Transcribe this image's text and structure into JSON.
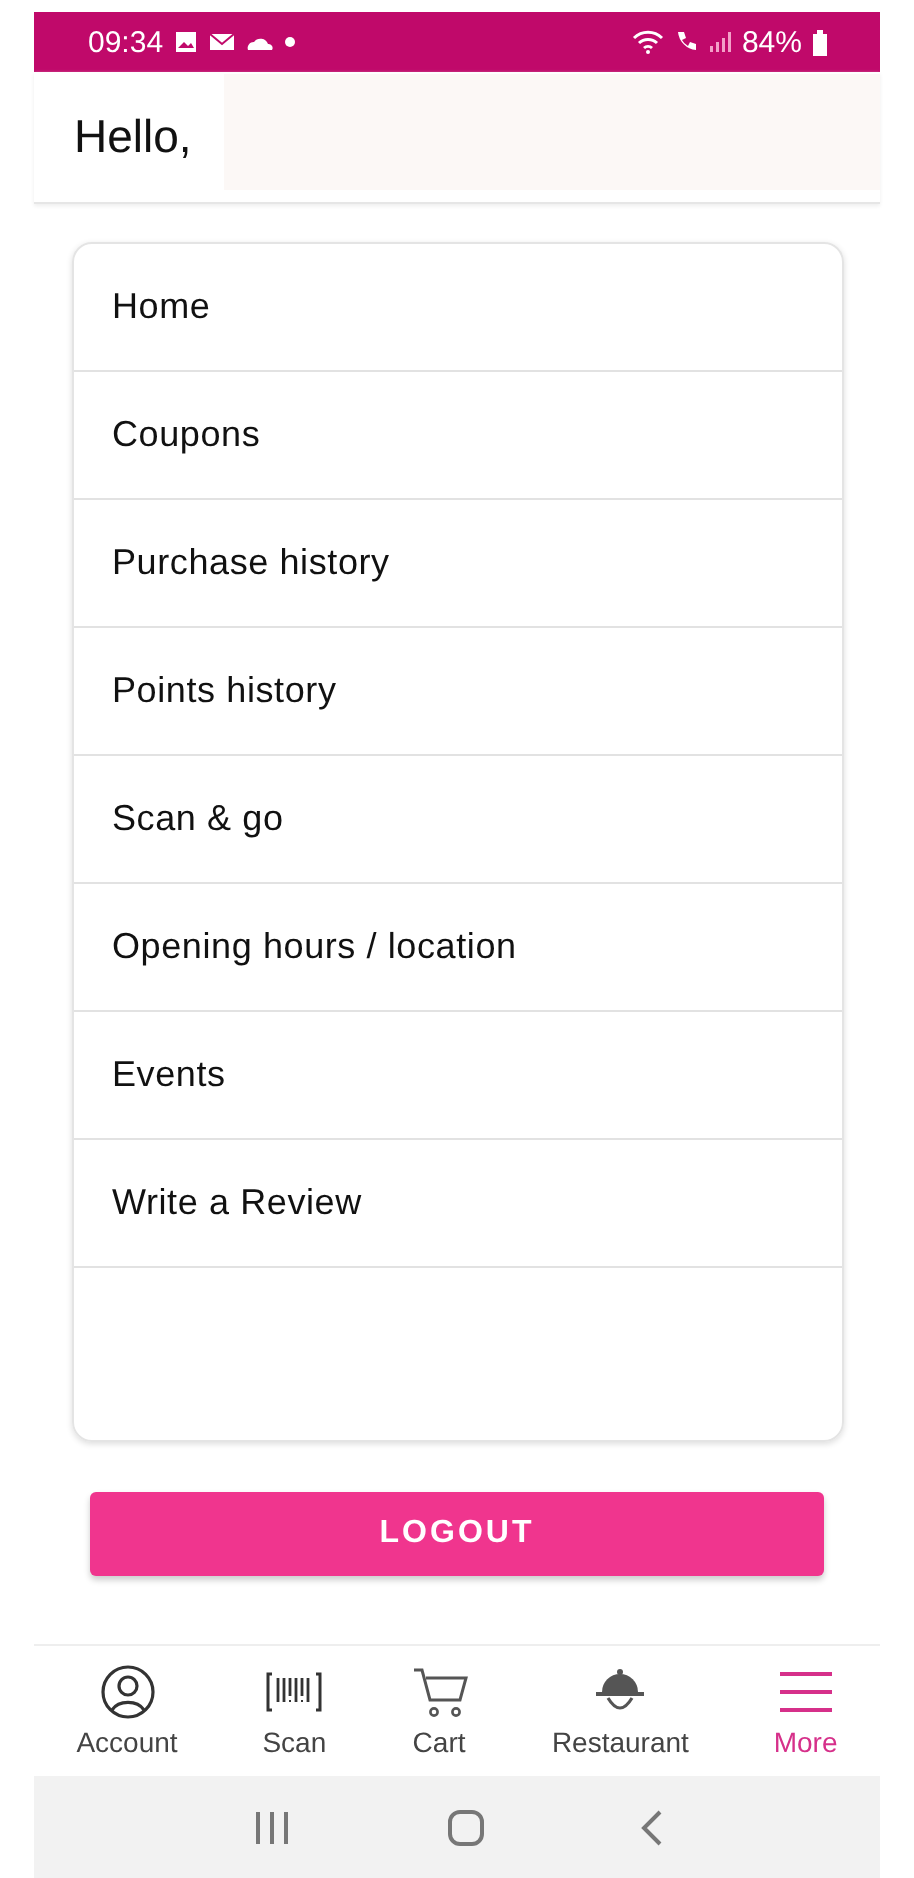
{
  "status_bar": {
    "time": "09:34",
    "battery": "84%"
  },
  "header": {
    "greeting": "Hello,"
  },
  "menu": [
    {
      "label": "Home"
    },
    {
      "label": "Coupons"
    },
    {
      "label": "Purchase history"
    },
    {
      "label": "Points history"
    },
    {
      "label": "Scan & go"
    },
    {
      "label": "Opening hours / location"
    },
    {
      "label": "Events"
    },
    {
      "label": "Write a Review"
    }
  ],
  "logout_button": "LOGOUT",
  "bottom_nav": [
    {
      "kind": "account",
      "label": "Account",
      "selected": false
    },
    {
      "kind": "scan",
      "label": "Scan",
      "selected": false
    },
    {
      "kind": "cart",
      "label": "Cart",
      "selected": false
    },
    {
      "kind": "restaurant",
      "label": "Restaurant",
      "selected": false
    },
    {
      "kind": "more",
      "label": "More",
      "selected": true
    }
  ]
}
